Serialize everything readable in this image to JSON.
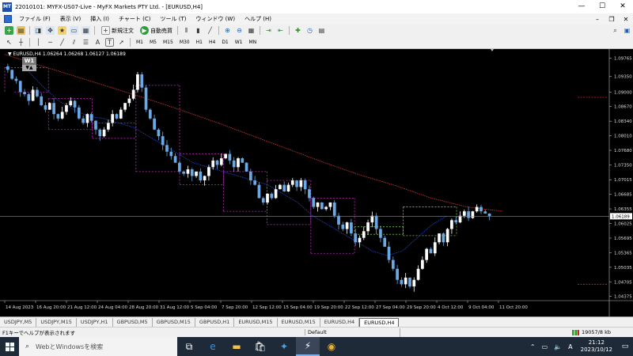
{
  "window": {
    "title": "22010101: MYFX-US07-Live - MyFX Markets PTY Ltd. - [EURUSD,H4]",
    "minimize": "—",
    "maximize": "☐",
    "close": "✕"
  },
  "menu": {
    "items": [
      "ファイル (F)",
      "表示 (V)",
      "挿入 (I)",
      "チャート (C)",
      "ツール (T)",
      "ウィンドウ (W)",
      "ヘルプ (H)"
    ],
    "mdi_min": "–",
    "mdi_restore": "❐",
    "mdi_close": "✕"
  },
  "toolbar": {
    "new_order": "新規注文",
    "auto_trading": "自動売買",
    "timeframes": [
      "M1",
      "M5",
      "M15",
      "M30",
      "H1",
      "H4",
      "D1",
      "W1",
      "MN"
    ],
    "text_tool": "A",
    "label_tool": "T"
  },
  "chart": {
    "header": "▼ EURUSD,H4  1.06264 1.06268 1.06127 1.06189",
    "overlay_label": "W1",
    "overlay_arrows": "▼▲",
    "current_price": "1.06189",
    "colors": {
      "candle": "#ffffff",
      "candle_down": "#6aa9e3",
      "ma_slow": "#c0332b",
      "ma_fast": "#1f3fbf",
      "box_magenta": "#c227c2",
      "box_green": "#7bc241",
      "bid_line": "#8c8c8c"
    }
  },
  "chart_data": {
    "type": "candlestick",
    "symbol": "EURUSD",
    "timeframe": "H4",
    "y_ticks": [
      "1.09765",
      "1.09350",
      "1.09000",
      "1.08670",
      "1.08340",
      "1.08010",
      "1.07680",
      "1.07350",
      "1.07015",
      "1.06685",
      "1.06355",
      "1.06025",
      "1.05695",
      "1.05365",
      "1.05035",
      "1.04705",
      "1.04375"
    ],
    "ylim": [
      1.04375,
      1.09765
    ],
    "x_ticks": [
      "14 Aug 2023",
      "16 Aug 20:00",
      "21 Aug 12:00",
      "24 Aug 04:00",
      "28 Aug 20:00",
      "31 Aug 12:00",
      "5 Sep 04:00",
      "7 Sep 20:00",
      "12 Sep 12:00",
      "15 Sep 04:00",
      "19 Sep 20:00",
      "22 Sep 12:00",
      "27 Sep 04:00",
      "29 Sep 20:00",
      "4 Oct 12:00",
      "9 Oct 04:00",
      "11 Oct 20:00"
    ],
    "close_path": [
      1.095,
      1.093,
      1.0925,
      1.09,
      1.0895,
      1.088,
      1.0905,
      1.089,
      1.087,
      1.086,
      1.0875,
      1.085,
      1.084,
      1.0855,
      1.087,
      1.088,
      1.0865,
      1.084,
      1.083,
      1.085,
      1.0835,
      1.0815,
      1.08,
      1.0815,
      1.083,
      1.085,
      1.084,
      1.086,
      1.0875,
      1.0885,
      1.0905,
      1.094,
      1.091,
      1.086,
      1.084,
      1.0815,
      1.08,
      1.078,
      1.0765,
      1.0755,
      1.074,
      1.072,
      1.0715,
      1.0725,
      1.071,
      1.072,
      1.07,
      1.071,
      1.073,
      1.0745,
      1.0735,
      1.075,
      1.076,
      1.0745,
      1.073,
      1.075,
      1.074,
      1.072,
      1.07,
      1.069,
      1.066,
      1.065,
      1.067,
      1.066,
      1.068,
      1.069,
      1.0675,
      1.069,
      1.07,
      1.0685,
      1.07,
      1.068,
      1.066,
      1.064,
      1.065,
      1.0635,
      1.064,
      1.065,
      1.062,
      1.06,
      1.059,
      1.0605,
      1.058,
      1.056,
      1.057,
      1.0585,
      1.0605,
      1.062,
      1.059,
      1.057,
      1.055,
      1.052,
      1.05,
      1.0475,
      1.0465,
      1.048,
      1.046,
      1.0475,
      1.05,
      1.052,
      1.0545,
      1.0535,
      1.056,
      1.058,
      1.056,
      1.059,
      1.061,
      1.0605,
      1.062,
      1.063,
      1.0615,
      1.063,
      1.064,
      1.063,
      1.0625,
      1.0619
    ],
    "ma_slow": [
      1.0985,
      1.096,
      1.0935,
      1.091,
      1.0885,
      1.0858,
      1.083,
      1.08,
      1.077,
      1.074,
      1.0712,
      1.0688,
      1.066,
      1.064,
      1.063
    ],
    "ma_fast": [
      1.0945,
      1.091,
      1.088,
      1.086,
      1.0845,
      1.084,
      1.083,
      1.082,
      1.08,
      1.078,
      1.076,
      1.074,
      1.073,
      1.072,
      1.071,
      1.07,
      1.069,
      1.067,
      1.065,
      1.062,
      1.06,
      1.058,
      1.056,
      1.054,
      1.053,
      1.054,
      1.057,
      1.06,
      1.062
    ],
    "ma_fast_start": 0.05,
    "ma_fast_end": 0.78,
    "magenta_levels": [
      {
        "from": 0.0,
        "to": 0.09,
        "y": 1.0955
      },
      {
        "from": 0.02,
        "to": 0.09,
        "y": 1.09
      },
      {
        "from": 0.09,
        "to": 0.18,
        "y": 1.0885
      },
      {
        "from": 0.09,
        "to": 0.18,
        "y": 1.0815
      },
      {
        "from": 0.18,
        "to": 0.27,
        "y": 1.083
      },
      {
        "from": 0.18,
        "to": 0.27,
        "y": 1.0795
      },
      {
        "from": 0.27,
        "to": 0.36,
        "y": 1.0915
      },
      {
        "from": 0.27,
        "to": 0.36,
        "y": 1.072
      },
      {
        "from": 0.36,
        "to": 0.45,
        "y": 1.076
      },
      {
        "from": 0.36,
        "to": 0.45,
        "y": 1.069
      },
      {
        "from": 0.45,
        "to": 0.54,
        "y": 1.072
      },
      {
        "from": 0.45,
        "to": 0.54,
        "y": 1.063
      },
      {
        "from": 0.54,
        "to": 0.63,
        "y": 1.07
      },
      {
        "from": 0.54,
        "to": 0.63,
        "y": 1.06
      },
      {
        "from": 0.63,
        "to": 0.72,
        "y": 1.066
      },
      {
        "from": 0.63,
        "to": 0.72,
        "y": 1.0535
      }
    ],
    "green_levels": [
      {
        "from": 0.72,
        "to": 0.82,
        "y": 1.0595
      },
      {
        "from": 0.72,
        "to": 0.82,
        "y": 1.0578
      },
      {
        "from": 0.82,
        "to": 0.93,
        "y": 1.064
      },
      {
        "from": 0.82,
        "to": 0.93,
        "y": 1.0575
      }
    ],
    "red_marker": {
      "y": 1.0888
    },
    "red_marker_low": {
      "y": 1.0465
    }
  },
  "tabs": [
    "USDJPY,M5",
    "USDJPY,M15",
    "USDJPY,H1",
    "GBPUSD,M5",
    "GBPUSD,M15",
    "GBPUSD,H1",
    "EURUSD,M15",
    "EURUSD,M15",
    "EURUSD,H4",
    "EURUSD,H4"
  ],
  "active_tab": 9,
  "status": {
    "help": "F1キーでヘルプが表示されます",
    "profile": "Default",
    "connection": "19057/8 kb"
  },
  "taskbar": {
    "search_placeholder": "WebとWindowsを検索",
    "time": "21:12",
    "date": "2023/10/12",
    "ime": "A"
  }
}
